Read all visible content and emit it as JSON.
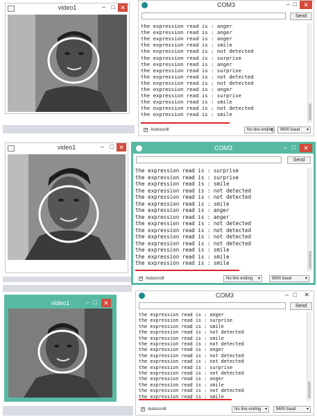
{
  "colors": {
    "accent_teal": "#58b9a3",
    "close_red": "#d24a3c",
    "underline_red": "#d8232a",
    "arduino_teal": "#1f8b8e"
  },
  "panels": [
    {
      "video": {
        "title": "video1",
        "minimize": "–",
        "maximize": "□",
        "close": "✕"
      },
      "serial": {
        "title": "COM3",
        "send_label": "Send",
        "autoscroll_label": "Autoscroll",
        "line_ending": "No line ending",
        "baud": "9600 baud",
        "lines": [
          "the expression read is : anger",
          "the expression read is : anger",
          "the expression read is : anger",
          "the expression read is : smile",
          "the expression read is : not detected",
          "the expression read is : surprise",
          "the expression read is : anger",
          "the expression read is : surprise",
          "the expression read is : not detected",
          "the expression read is : not detected",
          "the expression read is : anger",
          "the expression read is : surprise",
          "the expression read is : smile",
          "the expression read is : not detected",
          "the expression read is : smile"
        ]
      }
    },
    {
      "video": {
        "title": "video1",
        "minimize": "–",
        "maximize": "□",
        "close": "✕"
      },
      "serial": {
        "title": "COM3",
        "send_label": "Send",
        "autoscroll_label": "Autoscroll",
        "line_ending": "No line ending",
        "baud": "9600 baud",
        "lines": [
          "the expression read is : surprise",
          "the expression read is : surprise",
          "the expression read is : smile",
          "the expression read is : not detected",
          "the expression read is : not detected",
          "the expression read is : smile",
          "the expression read is : anger",
          "the expression read is : anger",
          "the expression read is : not detected",
          "the expression read is : not detected",
          "the expression read is : not detected",
          "the expression read is : not detected",
          "the expression read is : smile",
          "the expression read is : smile",
          "the expression read is : smile"
        ]
      }
    },
    {
      "video": {
        "title": "video1",
        "minimize": "–",
        "maximize": "□",
        "close": "✕"
      },
      "serial": {
        "title": "COM3",
        "send_label": "Send",
        "autoscroll_label": "Autoscroll",
        "line_ending": "No line ending",
        "baud": "9600 baud",
        "lines": [
          "the expression read is : anger",
          "the expression read is : surprise",
          "the expression read is : smile",
          "the expression read is : not detected",
          "the expression read is : smile",
          "the expression read is : not detected",
          "the expression read is : anger",
          "the expression read is : not detected",
          "the expression read is : not detected",
          "the expression read is : surprise",
          "the expression read is : not detected",
          "the expression read is : anger",
          "the expression read is : smile",
          "the expression read is : not detected",
          "the expression read is : smile"
        ]
      }
    }
  ]
}
